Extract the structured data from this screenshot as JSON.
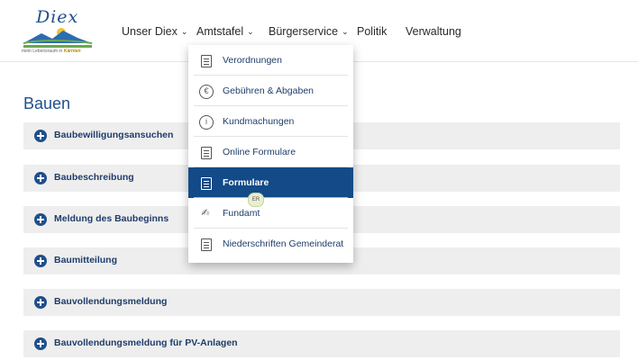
{
  "header": {
    "logo": {
      "word": "Diex",
      "tagline_prefix": "mein Lebensraum in",
      "tagline_accent": "Kärnten"
    },
    "nav": [
      {
        "label": "Unser Diex",
        "has_chevron": true
      },
      {
        "label": "Amtstafel",
        "has_chevron": true,
        "active": true
      },
      {
        "label": "Bürgerservice",
        "has_chevron": true
      },
      {
        "label": "Politik",
        "has_chevron": false
      },
      {
        "label": "Verwaltung",
        "has_chevron": false
      }
    ],
    "chevron_glyph": "⌄"
  },
  "dropdown": {
    "items": [
      {
        "label": "Verordnungen",
        "icon": "document-icon"
      },
      {
        "label": "Gebühren & Abgaben",
        "icon": "euro-icon",
        "glyph": "€"
      },
      {
        "label": "Kundmachungen",
        "icon": "info-icon",
        "glyph": "i"
      },
      {
        "label": "Online Formulare",
        "icon": "form-icon"
      },
      {
        "label": "Formulare",
        "icon": "document-icon",
        "active": true
      },
      {
        "label": "Fundamt",
        "icon": "hand-icon",
        "glyph": "✍"
      },
      {
        "label": "Niederschriften Gemeinderat",
        "icon": "document-icon"
      }
    ]
  },
  "cursor_badge": "ER",
  "main": {
    "title": "Bauen",
    "accordion": [
      "Baubewilligungsansuchen",
      "Baubeschreibung",
      "Meldung des Baubeginns",
      "Baumitteilung",
      "Bauvollendungsmeldung",
      "Bauvollendungsmeldung für PV-Anlagen"
    ]
  },
  "colors": {
    "brand": "#1f4f8b",
    "active_bg": "#134a87",
    "row_bg": "#eeeeee"
  }
}
